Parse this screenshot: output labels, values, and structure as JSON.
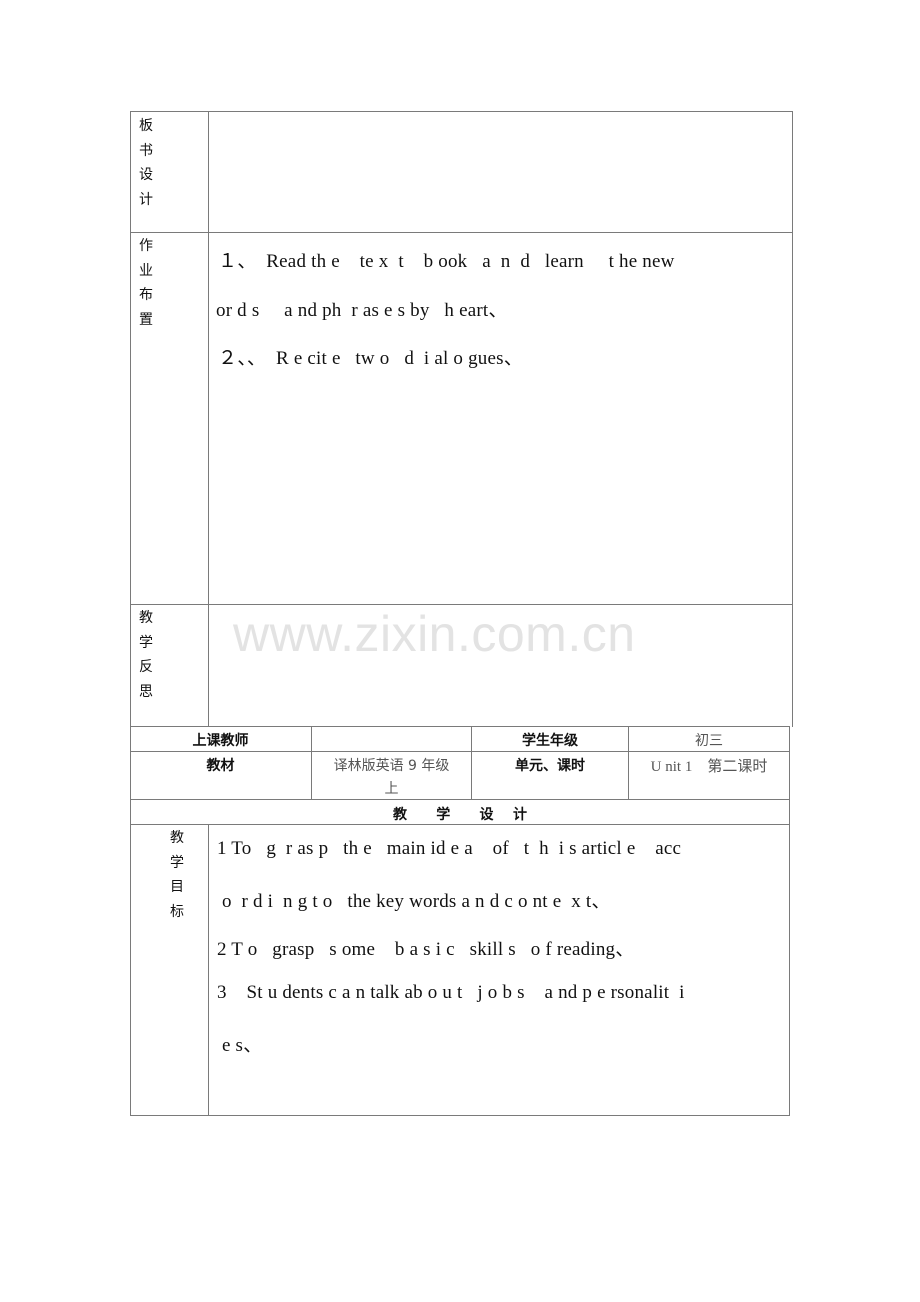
{
  "upper_table": {
    "rows": [
      {
        "label_chars": [
          "板",
          "书",
          "设",
          "计"
        ],
        "content_lines": []
      },
      {
        "label_chars": [
          "作",
          "业",
          "布",
          "置"
        ],
        "content_lines": [
          "１、  Read th e    te x  t    b ook   a  n  d   learn     t he new",
          "or d s     a nd ph  r as e s by   h eart、",
          "２、、  R e cit e   tw o   d  i al o gues、"
        ]
      },
      {
        "label_chars": [
          "教",
          "学",
          "反",
          "思"
        ],
        "content_lines": []
      }
    ]
  },
  "watermark": "www.zixin.com.cn",
  "info_table": {
    "teacher_label": "上课教师",
    "teacher_value": "",
    "grade_label": "学生年级",
    "grade_value": "初三",
    "textbook_label": "教材",
    "textbook_value_line1": "译林版英语 9 年级",
    "textbook_value_line2": "上",
    "unit_label": "单元、课时",
    "unit_value": "U nit 1    第二课时",
    "design_title": "教      学      设    计"
  },
  "objectives": {
    "label_chars": [
      "教",
      "学",
      "目",
      "标"
    ],
    "lines": [
      "1 To   g  r as p   th e   main id e a    of   t  h  i s articl e    acc",
      " o  r d i  n g t o   the key words a n d c o nt e  x t、",
      "2 T o   grasp   s ome    b a s i c   skill s   o f reading、",
      "3    St u dents c a n talk ab o u t   j o b s    a nd p e rsonalit  i",
      " e s、"
    ]
  }
}
